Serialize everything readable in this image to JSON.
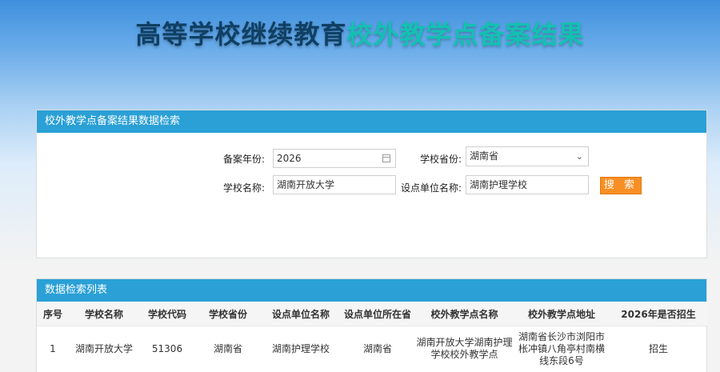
{
  "header": {
    "title_part1": "高等学校继续教育",
    "title_part2": "校外教学点备案结果"
  },
  "search": {
    "panel_title": "校外教学点备案结果数据检索",
    "year_label": "备案年份:",
    "year_value": "2026",
    "province_label": "学校省份:",
    "province_value": "湖南省",
    "school_label": "学校名称:",
    "school_value": "湖南开放大学",
    "unit_label": "设点单位名称:",
    "unit_value": "湖南护理学校",
    "search_button": "搜 索"
  },
  "list": {
    "panel_title": "数据检索列表",
    "columns": [
      "序号",
      "学校名称",
      "学校代码",
      "学校省份",
      "设点单位名称",
      "设点单位所在省",
      "校外教学点名称",
      "校外教学点地址",
      "2026年是否招生"
    ],
    "rows": [
      [
        "1",
        "湖南开放大学",
        "51306",
        "湖南省",
        "湖南护理学校",
        "湖南省",
        "湖南开放大学湖南护理学校校外教学点",
        "湖南省长沙市浏阳市枨冲镇八角亭村南横线东段6号",
        "招生"
      ]
    ]
  },
  "icons": {
    "calendar": "calendar-icon",
    "dropdown": "chevron-down-icon"
  },
  "colors": {
    "header_bar": "#2aa0d6",
    "button": "#f98f24",
    "title_dark": "#0f3f63",
    "title_accent": "#14c0b2"
  }
}
